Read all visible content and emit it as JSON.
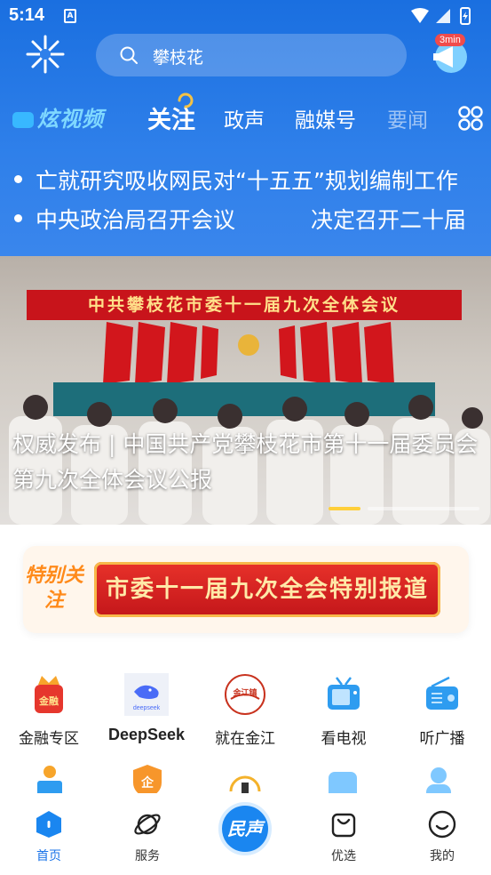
{
  "status_bar": {
    "time": "5:14",
    "sim_label": "A"
  },
  "header": {
    "search_text": "攀枝花",
    "timer_badge": "3min"
  },
  "tabs": {
    "brand": "炫视频",
    "items": [
      {
        "label": "关注",
        "active": true
      },
      {
        "label": "政声"
      },
      {
        "label": "融媒号"
      },
      {
        "label": "要闻"
      }
    ]
  },
  "news_ticker": [
    {
      "text": "亡就研究吸收网民对“十五五”规划编制工作"
    },
    {
      "text": "中央政治局召开会议",
      "text2": "决定召开二十届"
    }
  ],
  "hero": {
    "banner_text": "中共攀枝花市委十一届九次全体会议",
    "caption": "权威发布 | 中国共产党攀枝花市第十一届委员会第九次全体会议公报"
  },
  "special_report": {
    "tag": "特别关注",
    "title": "市委十一届九次全会特别报道"
  },
  "services": [
    {
      "label": "金融专区",
      "icon": "finance-icon"
    },
    {
      "label": "DeepSeek",
      "icon": "deepseek-icon",
      "sub": "deepseek"
    },
    {
      "label": "就在金江",
      "icon": "jinjiang-icon",
      "sub": "金江镇"
    },
    {
      "label": "看电视",
      "icon": "tv-icon"
    },
    {
      "label": "听广播",
      "icon": "radio-icon"
    }
  ],
  "bottom_nav": [
    {
      "label": "首页",
      "icon": "home-icon",
      "active": true
    },
    {
      "label": "服务",
      "icon": "planet-icon"
    },
    {
      "label": "民声",
      "icon": "minsheng-icon"
    },
    {
      "label": "优选",
      "icon": "bag-icon"
    },
    {
      "label": "我的",
      "icon": "smile-icon"
    }
  ],
  "colors": {
    "primary": "#1a73e8",
    "header_bg": "#2f80ea",
    "accent_red": "#c8141b"
  }
}
